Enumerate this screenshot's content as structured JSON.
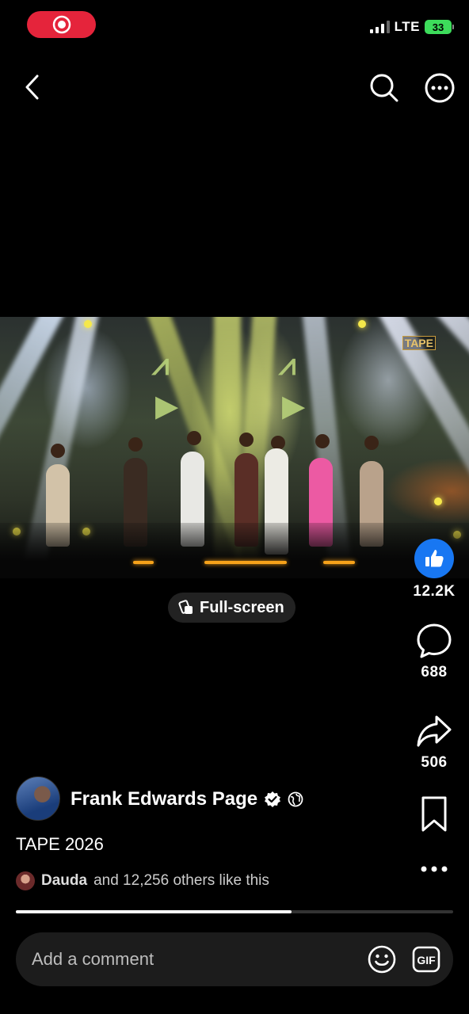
{
  "status_bar": {
    "network": "LTE",
    "battery": "33"
  },
  "nav": {
    "back_icon": "chevron-left-icon",
    "search_icon": "search-icon",
    "more_icon": "more-circle-icon"
  },
  "video": {
    "watermark": "TAPE",
    "progress": 0.63
  },
  "fullscreen_label": "Full-screen",
  "actions": {
    "likes": "12.2K",
    "comments": "688",
    "shares": "506"
  },
  "post": {
    "author": "Frank Edwards Page",
    "caption": "TAPE 2026",
    "liker": "Dauda",
    "likes_text": "and 12,256 others like this"
  },
  "comment_bar": {
    "placeholder": "Add a comment",
    "gif_label": "GIF"
  },
  "colors": {
    "accent": "#1877f2",
    "record": "#e5243b",
    "battery": "#3ddc5b"
  }
}
